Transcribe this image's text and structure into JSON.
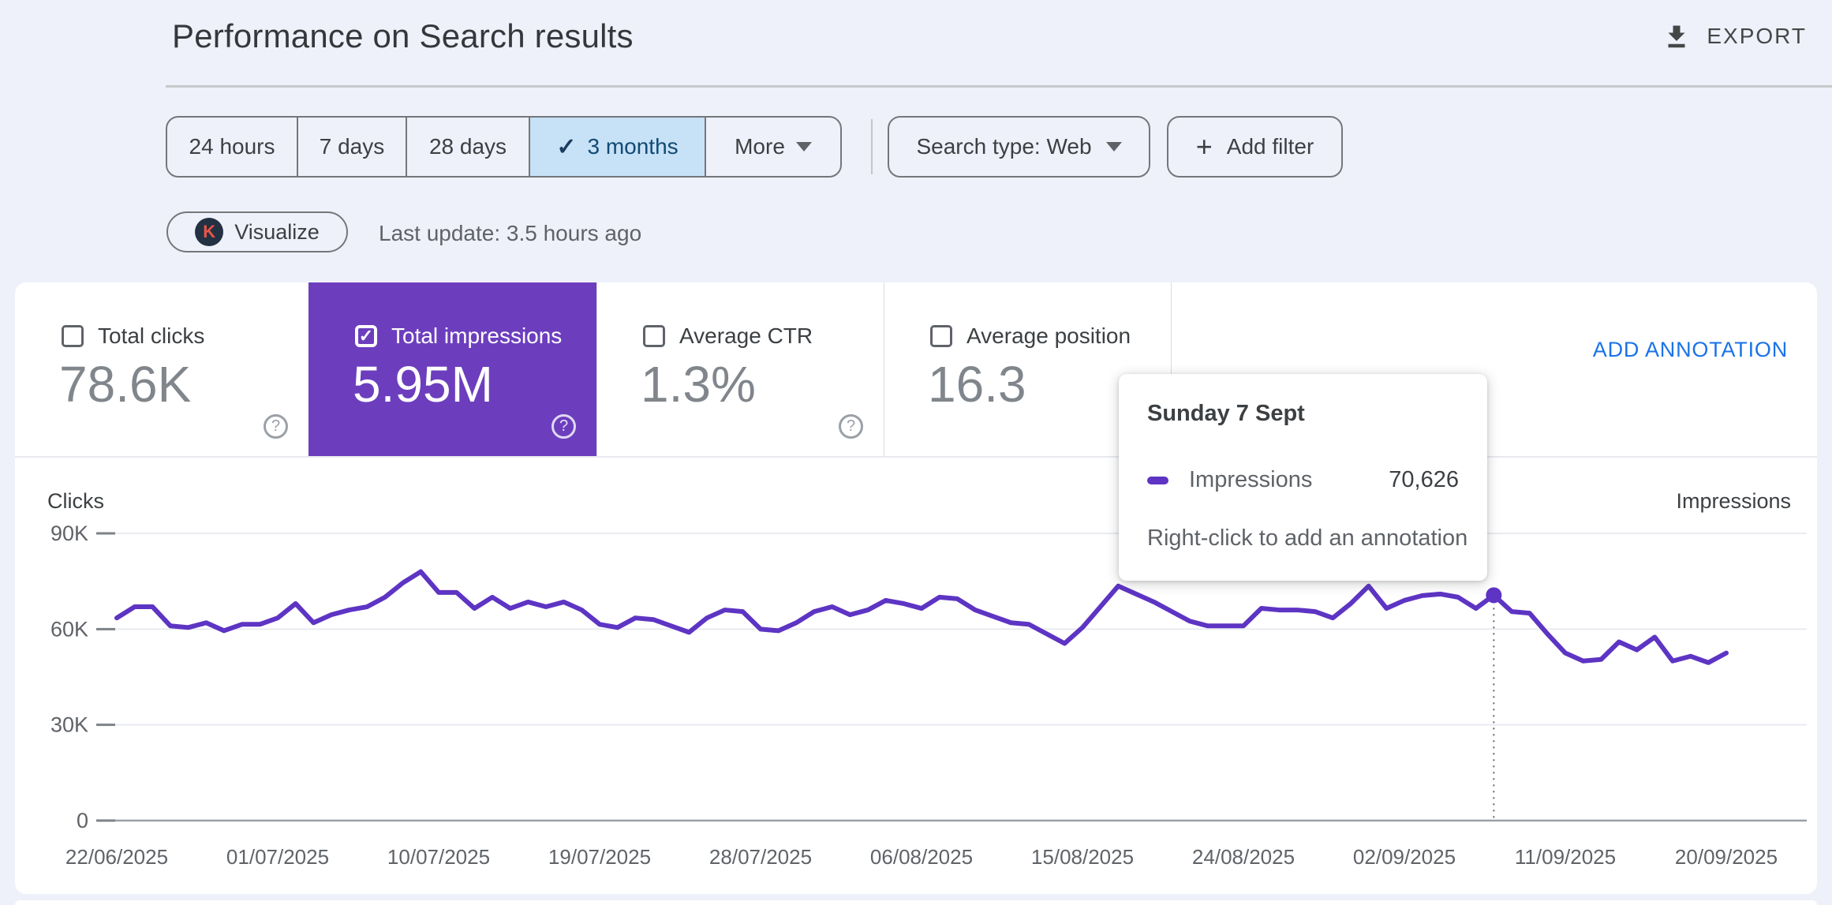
{
  "header": {
    "title": "Performance on Search results",
    "export_label": "EXPORT"
  },
  "filters": {
    "date_ranges": [
      {
        "label": "24 hours",
        "selected": false
      },
      {
        "label": "7 days",
        "selected": false
      },
      {
        "label": "28 days",
        "selected": false
      },
      {
        "label": "3 months",
        "selected": true
      },
      {
        "label": "More",
        "selected": false,
        "dropdown": true
      }
    ],
    "search_type_label": "Search type: Web",
    "add_filter_label": "Add filter"
  },
  "visualize": {
    "button_label": "Visualize",
    "last_update": "Last update: 3.5 hours ago"
  },
  "metrics": [
    {
      "label": "Total clicks",
      "value": "78.6K",
      "checked": false
    },
    {
      "label": "Total impressions",
      "value": "5.95M",
      "checked": true
    },
    {
      "label": "Average CTR",
      "value": "1.3%",
      "checked": false
    },
    {
      "label": "Average position",
      "value": "16.3",
      "checked": false
    }
  ],
  "annotation": {
    "add_label": "ADD ANNOTATION"
  },
  "tooltip": {
    "title": "Sunday 7 Sept",
    "series_label": "Impressions",
    "value": "70,626",
    "hint": "Right-click to add an annotation"
  },
  "chart_data": {
    "type": "line",
    "title": "",
    "left_axis_label": "Clicks",
    "right_axis_label": "Impressions",
    "ylim": [
      0,
      90000
    ],
    "grid": true,
    "legend_position": "none",
    "y_ticks": [
      {
        "label": "90K",
        "value": 90000
      },
      {
        "label": "60K",
        "value": 60000
      },
      {
        "label": "30K",
        "value": 30000
      },
      {
        "label": "0",
        "value": 0
      }
    ],
    "x_tick_labels": [
      "22/06/2025",
      "01/07/2025",
      "10/07/2025",
      "19/07/2025",
      "28/07/2025",
      "06/08/2025",
      "15/08/2025",
      "24/08/2025",
      "02/09/2025",
      "11/09/2025",
      "20/09/2025"
    ],
    "x_tick_step": 9,
    "series": [
      {
        "name": "Impressions",
        "color": "#5D34C3",
        "values": [
          63500,
          67000,
          67000,
          61000,
          60500,
          62000,
          59500,
          61500,
          61500,
          63500,
          68000,
          62000,
          64500,
          66000,
          67000,
          70000,
          74500,
          78000,
          71500,
          71500,
          66500,
          70000,
          66500,
          68500,
          67000,
          68500,
          66000,
          61500,
          60500,
          63500,
          63000,
          61000,
          59000,
          63500,
          66000,
          65500,
          60000,
          59500,
          62000,
          65500,
          67000,
          64500,
          66000,
          69000,
          68000,
          66500,
          70000,
          69500,
          66000,
          64000,
          62000,
          61500,
          58500,
          55500,
          60500,
          67000,
          73500,
          71000,
          68500,
          65500,
          62500,
          61000,
          61000,
          61000,
          66500,
          66000,
          66000,
          65500,
          63500,
          68000,
          73500,
          66500,
          69000,
          70500,
          71000,
          70000,
          66500,
          70626,
          65500,
          65000,
          58500,
          52500,
          50000,
          50500,
          56000,
          53500,
          57500,
          50000,
          51500,
          49500,
          52500
        ]
      }
    ],
    "highlight": {
      "index": 77,
      "date_label": "Sunday 7 Sept",
      "value": 70626,
      "formatted_value": "70,626"
    }
  },
  "colors": {
    "page_bg": "#EEF1FA",
    "selected_card_bg": "#6C3EBE",
    "line_purple": "#5D34C3",
    "selected_chip_bg": "#C7E1F6",
    "selected_chip_text": "#114A74",
    "link_blue": "#1A73E8",
    "k_icon_bg": "#233143",
    "k_icon_letter": "#EA5546"
  }
}
